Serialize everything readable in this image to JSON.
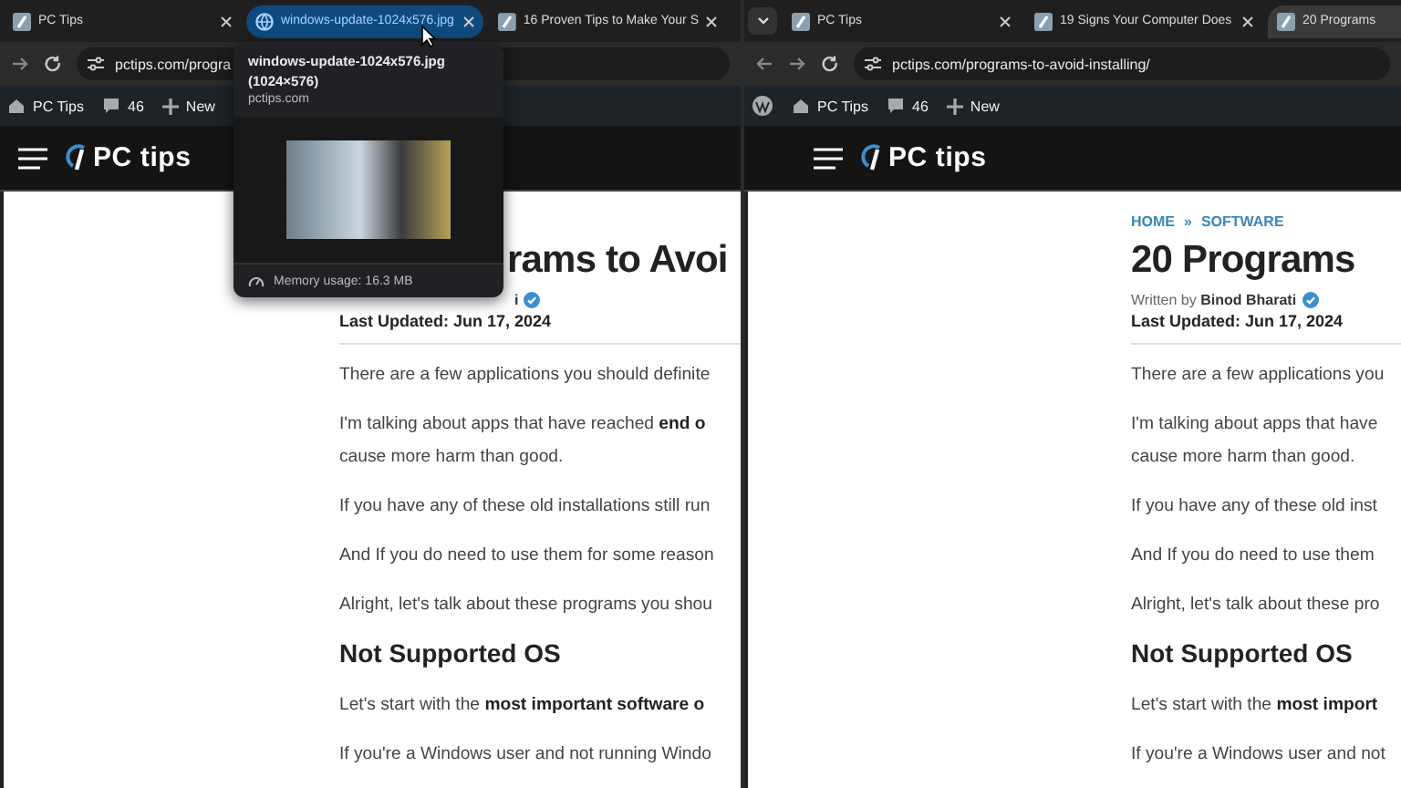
{
  "windows": [
    {
      "tabs": [
        {
          "title": "PC Tips",
          "kind": "page",
          "selected": false
        },
        {
          "title": "windows-update-1024x576.jpg",
          "kind": "image",
          "selected": true
        },
        {
          "title": "16 Proven Tips to Make Your S",
          "kind": "page",
          "selected": false
        }
      ],
      "nav_buttons": [
        {
          "kind": "forward"
        },
        {
          "kind": "reload"
        }
      ],
      "url": "pctips.com/progra",
      "admin_bar": [
        {
          "kind": "site",
          "label": "PC Tips"
        },
        {
          "kind": "comments",
          "label": "46"
        },
        {
          "kind": "new",
          "label": "New"
        }
      ],
      "logo": "PC tips",
      "article": {
        "covered": true,
        "title": "rams to Avoi",
        "author": "**i**",
        "updated": "Last Updated: Jun 17, 2024",
        "blocks": [
          {
            "kind": "p",
            "lines": [
              "There are a few applications you should definite"
            ]
          },
          {
            "kind": "p",
            "lines": [
              "I'm talking about apps that have reached **end o**",
              "cause more harm than good."
            ]
          },
          {
            "kind": "p",
            "lines": [
              "If you have any of these old installations still run"
            ]
          },
          {
            "kind": "p",
            "lines": [
              "And If you do need to use them for some reason"
            ]
          },
          {
            "kind": "p",
            "lines": [
              "Alright, let's talk about these programs you shou"
            ]
          },
          {
            "kind": "h2",
            "lines": [
              "Not Supported OS"
            ]
          },
          {
            "kind": "p",
            "lines": [
              "Let's start with the **most important software o**"
            ]
          },
          {
            "kind": "p",
            "lines": [
              "If you're a Windows user and not running Windo"
            ]
          }
        ]
      },
      "preview": {
        "title": "windows-update-1024x576.jpg",
        "size": "(1024×576)",
        "site": "pctips.com",
        "memory": "Memory usage: 16.3 MB"
      }
    },
    {
      "tab_menu": true,
      "tabs": [
        {
          "title": "PC Tips",
          "kind": "page",
          "selected": false
        },
        {
          "title": "19 Signs Your Computer Does",
          "kind": "page",
          "selected": false
        },
        {
          "title": "20 Programs",
          "kind": "page",
          "selected": true
        }
      ],
      "nav_buttons": [
        {
          "kind": "back"
        },
        {
          "kind": "forward"
        },
        {
          "kind": "reload"
        }
      ],
      "url": "pctips.com/programs-to-avoid-installing/",
      "admin_bar": [
        {
          "kind": "wp"
        },
        {
          "kind": "site",
          "label": "PC Tips"
        },
        {
          "kind": "comments",
          "label": "46"
        },
        {
          "kind": "new",
          "label": "New"
        }
      ],
      "logo": "PC tips",
      "article": {
        "covered": false,
        "breadcrumb": [
          "HOME",
          "»",
          "SOFTWARE"
        ],
        "title": "20 Programs",
        "author": "Written by **Binod Bharati**",
        "updated": "Last Updated: Jun 17, 2024",
        "blocks": [
          {
            "kind": "p",
            "lines": [
              "There are a few applications you"
            ]
          },
          {
            "kind": "p",
            "lines": [
              "I'm talking about apps that have",
              "cause more harm than good."
            ]
          },
          {
            "kind": "p",
            "lines": [
              "If you have any of these old inst"
            ]
          },
          {
            "kind": "p",
            "lines": [
              "And If you do need to use them"
            ]
          },
          {
            "kind": "p",
            "lines": [
              "Alright, let's talk about these pro"
            ]
          },
          {
            "kind": "h2",
            "lines": [
              "Not Supported OS"
            ]
          },
          {
            "kind": "p",
            "lines": [
              "Let's start with the **most import**"
            ]
          },
          {
            "kind": "p",
            "lines": [
              "If you're a Windows user and not"
            ]
          }
        ]
      }
    }
  ]
}
